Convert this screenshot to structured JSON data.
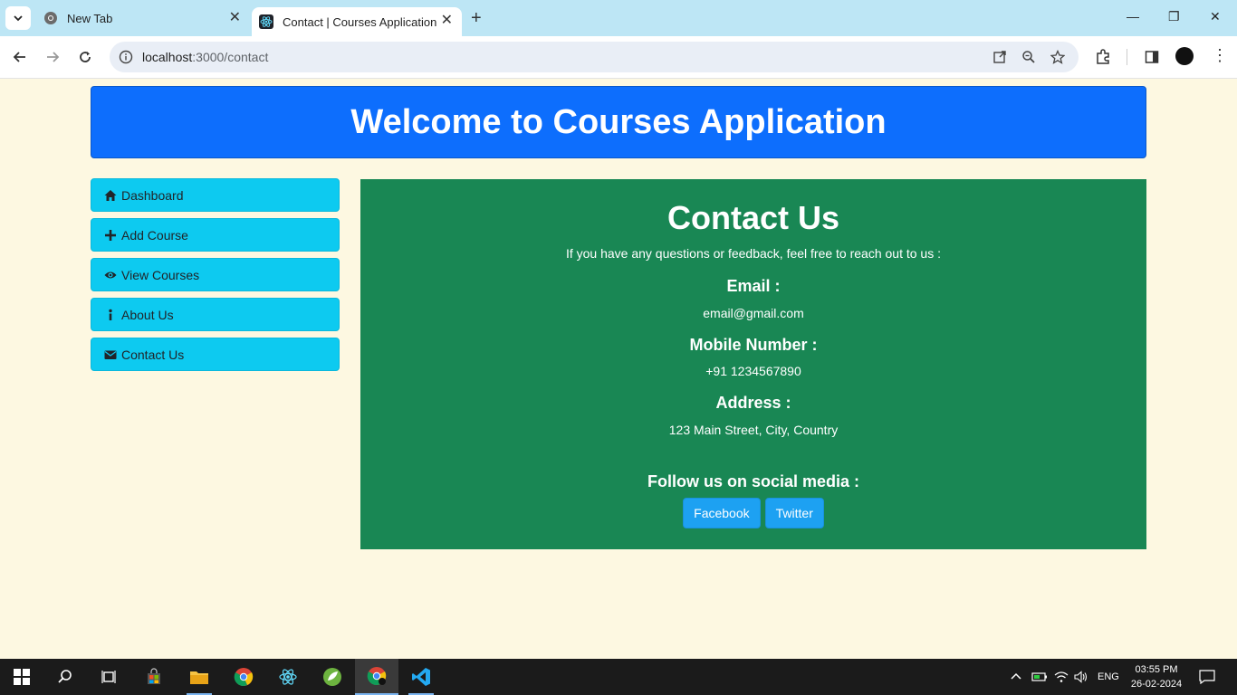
{
  "browser": {
    "tabs": [
      {
        "label": "New Tab",
        "icon": "chrome-icon",
        "active": false
      },
      {
        "label": "Contact | Courses Application",
        "icon": "react-icon",
        "active": true
      }
    ],
    "address": {
      "host": "localhost",
      "path": ":3000/contact"
    }
  },
  "header": {
    "title": "Welcome to Courses Application"
  },
  "sidebar": {
    "items": [
      {
        "label": "Dashboard",
        "icon": "home-icon"
      },
      {
        "label": "Add Course",
        "icon": "plus-icon"
      },
      {
        "label": "View Courses",
        "icon": "eye-icon"
      },
      {
        "label": "About Us",
        "icon": "info-icon"
      },
      {
        "label": "Contact Us",
        "icon": "envelope-icon"
      }
    ]
  },
  "contact": {
    "title": "Contact Us",
    "intro": "If you have any questions or feedback, feel free to reach out to us :",
    "email_label": "Email :",
    "email_value": "email@gmail.com",
    "mobile_label": "Mobile Number :",
    "mobile_value": "+91 1234567890",
    "address_label": "Address :",
    "address_value": "123 Main Street, City, Country",
    "social_label": "Follow us on social media :",
    "facebook_label": "Facebook",
    "twitter_label": "Twitter"
  },
  "taskbar": {
    "language": "ENG",
    "time": "03:55 PM",
    "date": "26-02-2024"
  },
  "colors": {
    "header_bg": "#0d6efd",
    "sidebar_bg": "#0dcaf0",
    "card_bg": "#198754",
    "social_btn_bg": "#1da1f2",
    "page_bg": "#fdf8e1"
  }
}
